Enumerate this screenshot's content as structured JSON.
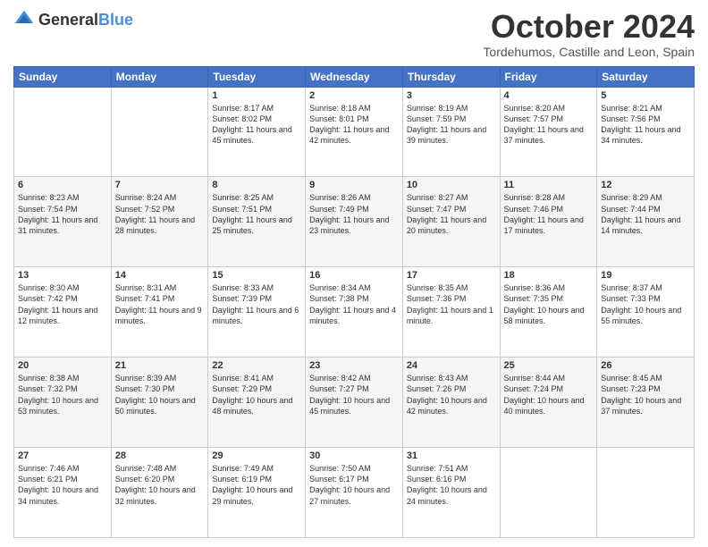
{
  "header": {
    "logo_general": "General",
    "logo_blue": "Blue",
    "month_title": "October 2024",
    "subtitle": "Tordehumos, Castille and Leon, Spain"
  },
  "weekdays": [
    "Sunday",
    "Monday",
    "Tuesday",
    "Wednesday",
    "Thursday",
    "Friday",
    "Saturday"
  ],
  "weeks": [
    [
      {
        "day": "",
        "content": ""
      },
      {
        "day": "",
        "content": ""
      },
      {
        "day": "1",
        "content": "Sunrise: 8:17 AM\nSunset: 8:02 PM\nDaylight: 11 hours and 45 minutes."
      },
      {
        "day": "2",
        "content": "Sunrise: 8:18 AM\nSunset: 8:01 PM\nDaylight: 11 hours and 42 minutes."
      },
      {
        "day": "3",
        "content": "Sunrise: 8:19 AM\nSunset: 7:59 PM\nDaylight: 11 hours and 39 minutes."
      },
      {
        "day": "4",
        "content": "Sunrise: 8:20 AM\nSunset: 7:57 PM\nDaylight: 11 hours and 37 minutes."
      },
      {
        "day": "5",
        "content": "Sunrise: 8:21 AM\nSunset: 7:56 PM\nDaylight: 11 hours and 34 minutes."
      }
    ],
    [
      {
        "day": "6",
        "content": "Sunrise: 8:23 AM\nSunset: 7:54 PM\nDaylight: 11 hours and 31 minutes."
      },
      {
        "day": "7",
        "content": "Sunrise: 8:24 AM\nSunset: 7:52 PM\nDaylight: 11 hours and 28 minutes."
      },
      {
        "day": "8",
        "content": "Sunrise: 8:25 AM\nSunset: 7:51 PM\nDaylight: 11 hours and 25 minutes."
      },
      {
        "day": "9",
        "content": "Sunrise: 8:26 AM\nSunset: 7:49 PM\nDaylight: 11 hours and 23 minutes."
      },
      {
        "day": "10",
        "content": "Sunrise: 8:27 AM\nSunset: 7:47 PM\nDaylight: 11 hours and 20 minutes."
      },
      {
        "day": "11",
        "content": "Sunrise: 8:28 AM\nSunset: 7:46 PM\nDaylight: 11 hours and 17 minutes."
      },
      {
        "day": "12",
        "content": "Sunrise: 8:29 AM\nSunset: 7:44 PM\nDaylight: 11 hours and 14 minutes."
      }
    ],
    [
      {
        "day": "13",
        "content": "Sunrise: 8:30 AM\nSunset: 7:42 PM\nDaylight: 11 hours and 12 minutes."
      },
      {
        "day": "14",
        "content": "Sunrise: 8:31 AM\nSunset: 7:41 PM\nDaylight: 11 hours and 9 minutes."
      },
      {
        "day": "15",
        "content": "Sunrise: 8:33 AM\nSunset: 7:39 PM\nDaylight: 11 hours and 6 minutes."
      },
      {
        "day": "16",
        "content": "Sunrise: 8:34 AM\nSunset: 7:38 PM\nDaylight: 11 hours and 4 minutes."
      },
      {
        "day": "17",
        "content": "Sunrise: 8:35 AM\nSunset: 7:36 PM\nDaylight: 11 hours and 1 minute."
      },
      {
        "day": "18",
        "content": "Sunrise: 8:36 AM\nSunset: 7:35 PM\nDaylight: 10 hours and 58 minutes."
      },
      {
        "day": "19",
        "content": "Sunrise: 8:37 AM\nSunset: 7:33 PM\nDaylight: 10 hours and 55 minutes."
      }
    ],
    [
      {
        "day": "20",
        "content": "Sunrise: 8:38 AM\nSunset: 7:32 PM\nDaylight: 10 hours and 53 minutes."
      },
      {
        "day": "21",
        "content": "Sunrise: 8:39 AM\nSunset: 7:30 PM\nDaylight: 10 hours and 50 minutes."
      },
      {
        "day": "22",
        "content": "Sunrise: 8:41 AM\nSunset: 7:29 PM\nDaylight: 10 hours and 48 minutes."
      },
      {
        "day": "23",
        "content": "Sunrise: 8:42 AM\nSunset: 7:27 PM\nDaylight: 10 hours and 45 minutes."
      },
      {
        "day": "24",
        "content": "Sunrise: 8:43 AM\nSunset: 7:26 PM\nDaylight: 10 hours and 42 minutes."
      },
      {
        "day": "25",
        "content": "Sunrise: 8:44 AM\nSunset: 7:24 PM\nDaylight: 10 hours and 40 minutes."
      },
      {
        "day": "26",
        "content": "Sunrise: 8:45 AM\nSunset: 7:23 PM\nDaylight: 10 hours and 37 minutes."
      }
    ],
    [
      {
        "day": "27",
        "content": "Sunrise: 7:46 AM\nSunset: 6:21 PM\nDaylight: 10 hours and 34 minutes."
      },
      {
        "day": "28",
        "content": "Sunrise: 7:48 AM\nSunset: 6:20 PM\nDaylight: 10 hours and 32 minutes."
      },
      {
        "day": "29",
        "content": "Sunrise: 7:49 AM\nSunset: 6:19 PM\nDaylight: 10 hours and 29 minutes."
      },
      {
        "day": "30",
        "content": "Sunrise: 7:50 AM\nSunset: 6:17 PM\nDaylight: 10 hours and 27 minutes."
      },
      {
        "day": "31",
        "content": "Sunrise: 7:51 AM\nSunset: 6:16 PM\nDaylight: 10 hours and 24 minutes."
      },
      {
        "day": "",
        "content": ""
      },
      {
        "day": "",
        "content": ""
      }
    ]
  ]
}
